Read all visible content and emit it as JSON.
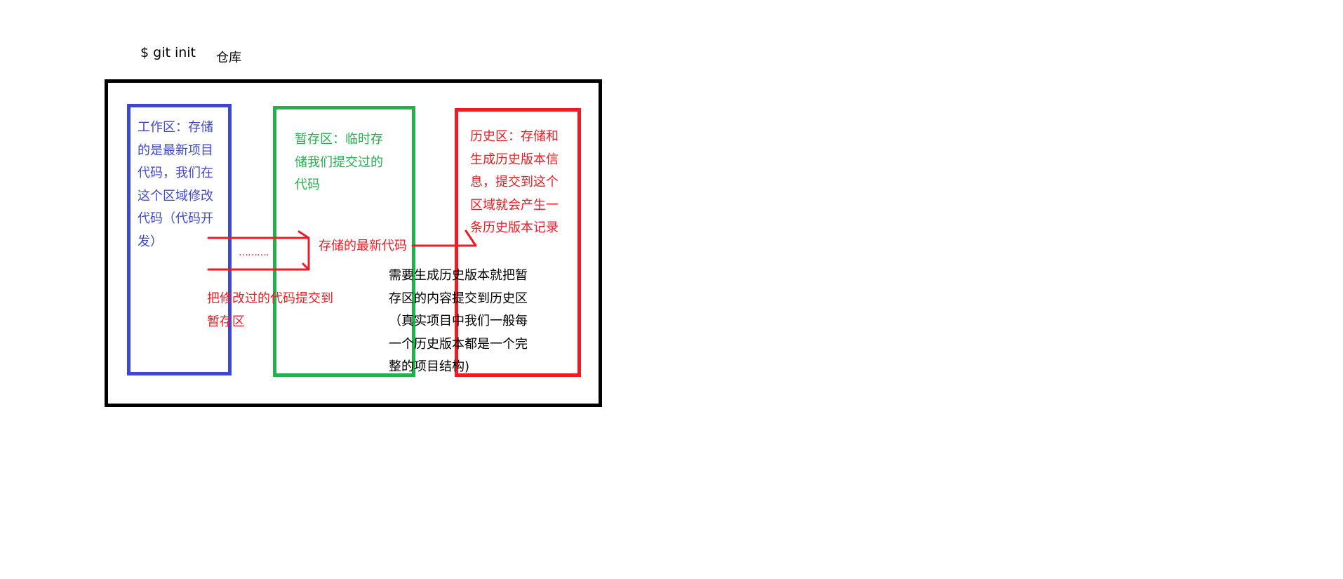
{
  "header": {
    "command": "$ git init",
    "repository_label": "仓库"
  },
  "areas": {
    "working": {
      "text": "工作区：存储的是最新项目代码，我们在这个区域修改代码（代码开发）",
      "color": "#3f48cc"
    },
    "staging": {
      "text": "暂存区：临时存储我们提交过的代码",
      "color": "#22b14c"
    },
    "history": {
      "text": "历史区：存储和生成历史版本信息，提交到这个区域就会产生一条历史版本记录",
      "color": "#ed1c24"
    }
  },
  "annotations": {
    "latest_code": "存储的最新代码",
    "ellipsis": "……….",
    "commit_to_staging": "把修改过的代码提交到暂存区",
    "commit_to_history": "需要生成历史版本就把暂存区的内容提交到历史区（真实项目中我们一般每一个历史版本都是一个完整的项目结构)"
  },
  "colors": {
    "repository_border": "#000000",
    "arrow": "#ed1c24"
  }
}
